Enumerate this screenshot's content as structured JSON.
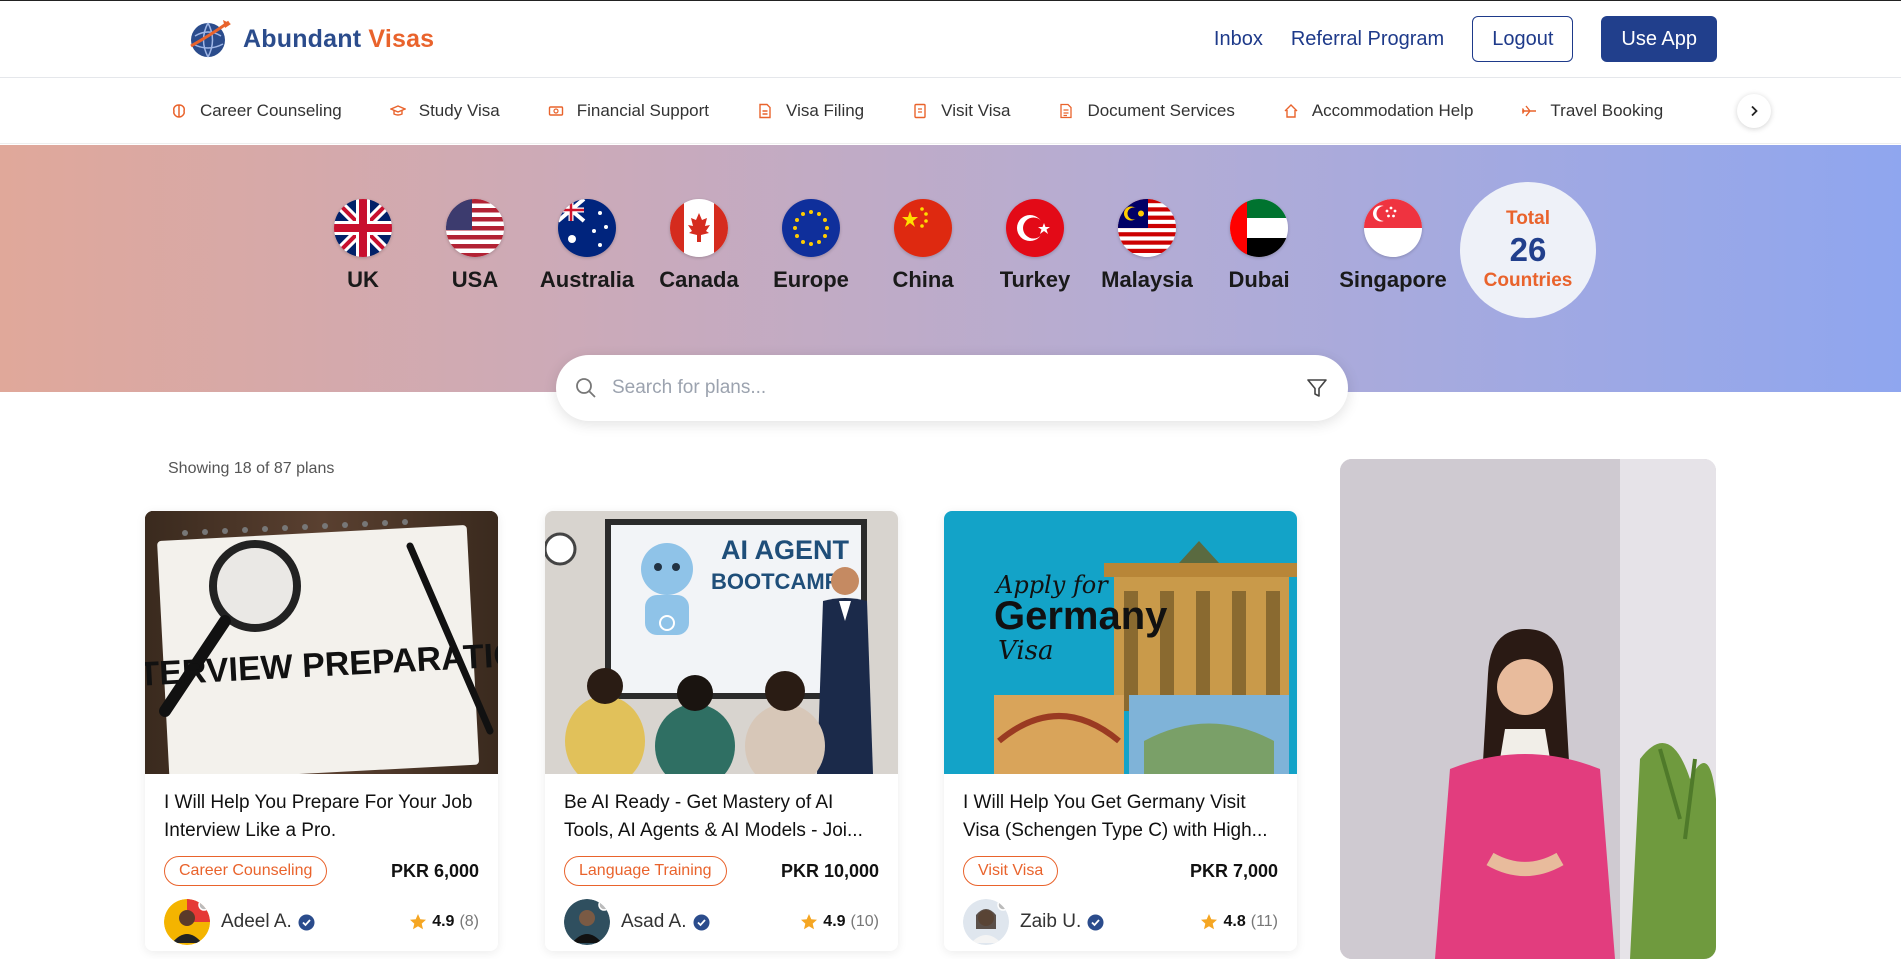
{
  "brand": {
    "name_part1": "Abundant",
    "name_part2": "Visas"
  },
  "nav": {
    "inbox": "Inbox",
    "referral": "Referral Program",
    "logout": "Logout",
    "use_app": "Use App"
  },
  "categories": [
    {
      "label": "Career Counseling",
      "icon": "brain-icon"
    },
    {
      "label": "Study Visa",
      "icon": "graduation-cap-icon"
    },
    {
      "label": "Financial Support",
      "icon": "cash-icon"
    },
    {
      "label": "Visa Filing",
      "icon": "file-icon"
    },
    {
      "label": "Visit Visa",
      "icon": "document-icon"
    },
    {
      "label": "Document Services",
      "icon": "documents-icon"
    },
    {
      "label": "Accommodation Help",
      "icon": "home-icon"
    },
    {
      "label": "Travel Booking",
      "icon": "plane-icon"
    }
  ],
  "countries": [
    {
      "name": "UK"
    },
    {
      "name": "USA"
    },
    {
      "name": "Australia"
    },
    {
      "name": "Canada"
    },
    {
      "name": "Europe"
    },
    {
      "name": "China"
    },
    {
      "name": "Turkey"
    },
    {
      "name": "Malaysia"
    },
    {
      "name": "Dubai"
    },
    {
      "name": "Singapore"
    }
  ],
  "total": {
    "label_top": "Total",
    "count": "26",
    "label_bottom": "Countries"
  },
  "search": {
    "placeholder": "Search for plans..."
  },
  "showing": "Showing 18 of 87 plans",
  "cards": [
    {
      "title": "I Will Help You Prepare For Your Job Interview Like a Pro.",
      "tag": "Career Counseling",
      "price": "PKR 6,000",
      "author": "Adeel A.",
      "rating": "4.9",
      "reviews": "(8)",
      "image_text": "INTERVIEW PREPARATION"
    },
    {
      "title": "Be AI Ready - Get Mastery of AI Tools, AI Agents & AI Models - Joi...",
      "tag": "Language Training",
      "price": "PKR 10,000",
      "author": "Asad A.",
      "rating": "4.9",
      "reviews": "(10)",
      "image_text_1": "AI AGENT",
      "image_text_2": "BOOTCAMP"
    },
    {
      "title": "I Will Help You Get Germany Visit Visa (Schengen Type C) with High...",
      "tag": "Visit Visa",
      "price": "PKR 7,000",
      "author": "Zaib U.",
      "rating": "4.8",
      "reviews": "(11)",
      "image_text_1": "Apply for",
      "image_text_2": "Germany",
      "image_text_3": "Visa"
    }
  ],
  "colors": {
    "primary": "#213f8c",
    "accent": "#e9632c",
    "star": "#f5a623",
    "verified": "#2b4c8c"
  }
}
